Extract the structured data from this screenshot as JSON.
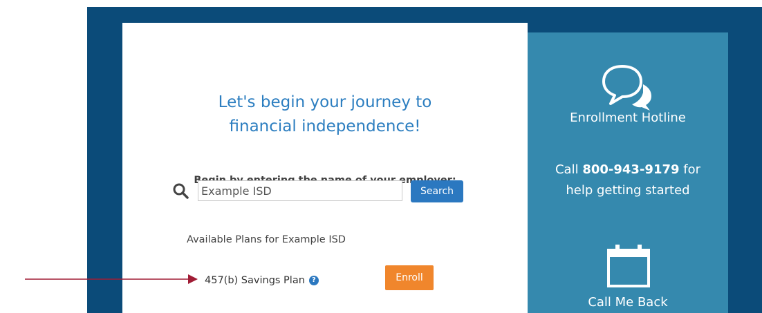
{
  "main": {
    "headline_line1": "Let's begin your journey to",
    "headline_line2": "financial independence!",
    "prompt": "Begin by entering the name of your employer:",
    "search_value": "Example ISD",
    "search_button": "Search",
    "plans_heading": "Available Plans for Example ISD",
    "plans": [
      {
        "name": "457(b) Savings Plan",
        "action": "Enroll"
      }
    ]
  },
  "sidebar": {
    "hotline_title": "Enrollment Hotline",
    "call_prefix": "Call",
    "phone": "800-943-9179",
    "call_suffix": "for",
    "help_text": "help getting started",
    "callback_title": "Call Me Back"
  },
  "icons": {
    "search": "search-icon",
    "help": "question-circle-icon",
    "chat": "chat-bubbles-icon",
    "calendar": "calendar-icon",
    "arrow": "arrow-right-icon"
  },
  "colors": {
    "frame": "#0b4b79",
    "sidebar": "#3589ae",
    "headline": "#2c7ec0",
    "primary_button": "#2b78c0",
    "enroll_button": "#f0862c",
    "arrow": "#a01c35"
  }
}
